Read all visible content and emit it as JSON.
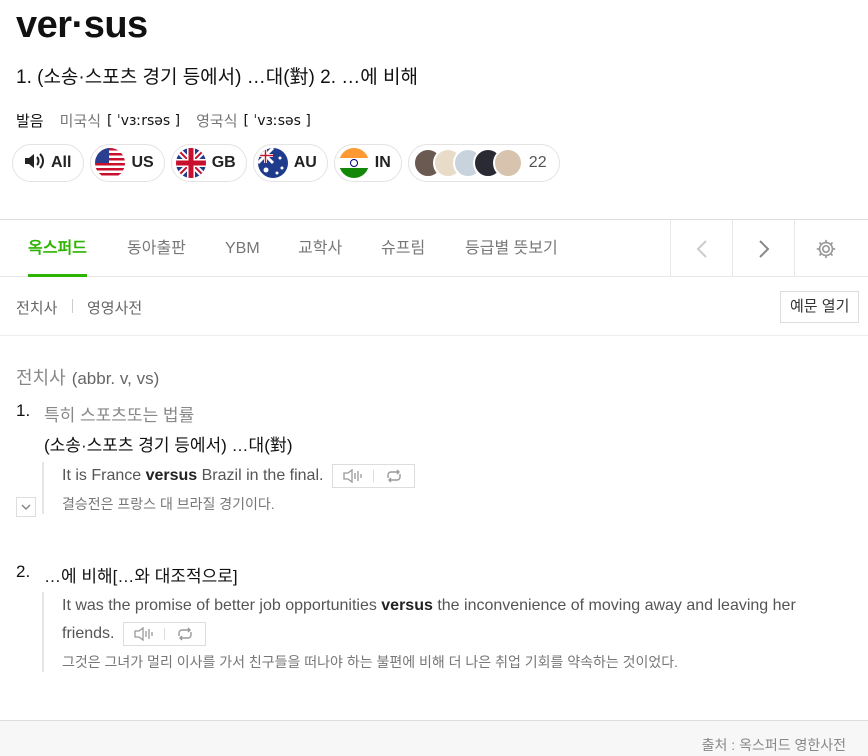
{
  "entry": {
    "headword": "ver·sus",
    "summary": "1. (소송·스포츠 경기 등에서) …대(對) 2. …에 비해"
  },
  "pronunciation": {
    "label": "발음",
    "us_label": "미국식",
    "us_ipa": "[ ˈvɜːrsəs ]",
    "uk_label": "영국식",
    "uk_ipa": "[ ˈvɜːsəs ]"
  },
  "audio": {
    "all_label": "All",
    "regions": [
      "US",
      "GB",
      "AU",
      "IN"
    ],
    "user_count": "22"
  },
  "tabs": [
    "옥스퍼드",
    "동아출판",
    "YBM",
    "교학사",
    "슈프림",
    "등급별 뜻보기"
  ],
  "active_tab": "옥스퍼드",
  "sub_nav": {
    "items": [
      "전치사",
      "영영사전"
    ],
    "example_toggle": "예문 열기"
  },
  "part_of_speech": {
    "label": "전치사",
    "abbr": "(abbr. v, vs)"
  },
  "senses": [
    {
      "num": "1.",
      "gloss": "특히 스포츠또는 법률",
      "def": "(소송·스포츠 경기 등에서) …대(對)",
      "example_before": "It is France ",
      "example_bold": "versus",
      "example_after": " Brazil in the final.",
      "translation": "결승전은 프랑스 대 브라질 경기이다."
    },
    {
      "num": "2.",
      "def": "…에 비해[…와 대조적으로]",
      "example_before": "It was the promise of better job opportunities ",
      "example_bold": "versus",
      "example_after": " the inconvenience of moving away and leaving her friends.",
      "translation": "그것은 그녀가 멀리 이사를 가서 친구들을 떠나야 하는 불편에 비해 더 나은 취업 기회를 약속하는 것이었다."
    }
  ],
  "footer": {
    "source": "출처 : 옥스퍼드 영한사전"
  },
  "colors": {
    "accent": "#2db400"
  }
}
